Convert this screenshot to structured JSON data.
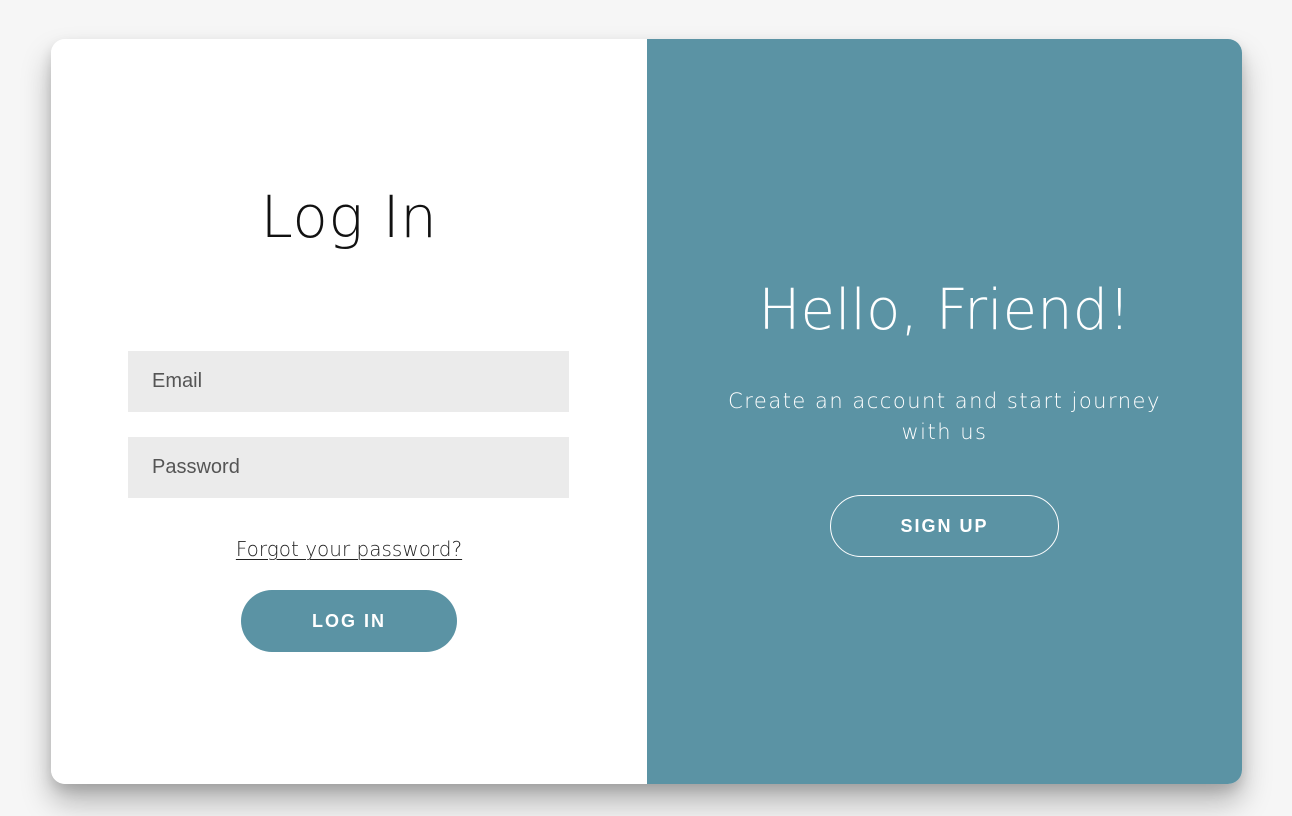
{
  "login": {
    "title": "Log In",
    "email_placeholder": "Email",
    "password_placeholder": "Password",
    "forgot_link": "Forgot your password?",
    "submit_label": "LOG IN"
  },
  "signup_panel": {
    "title": "Hello, Friend!",
    "subtitle": "Create an account and start journey with us",
    "button_label": "SIGN UP"
  },
  "colors": {
    "accent": "#5b93a4",
    "input_background": "#ebebeb",
    "panel_text": "#ffffff"
  }
}
